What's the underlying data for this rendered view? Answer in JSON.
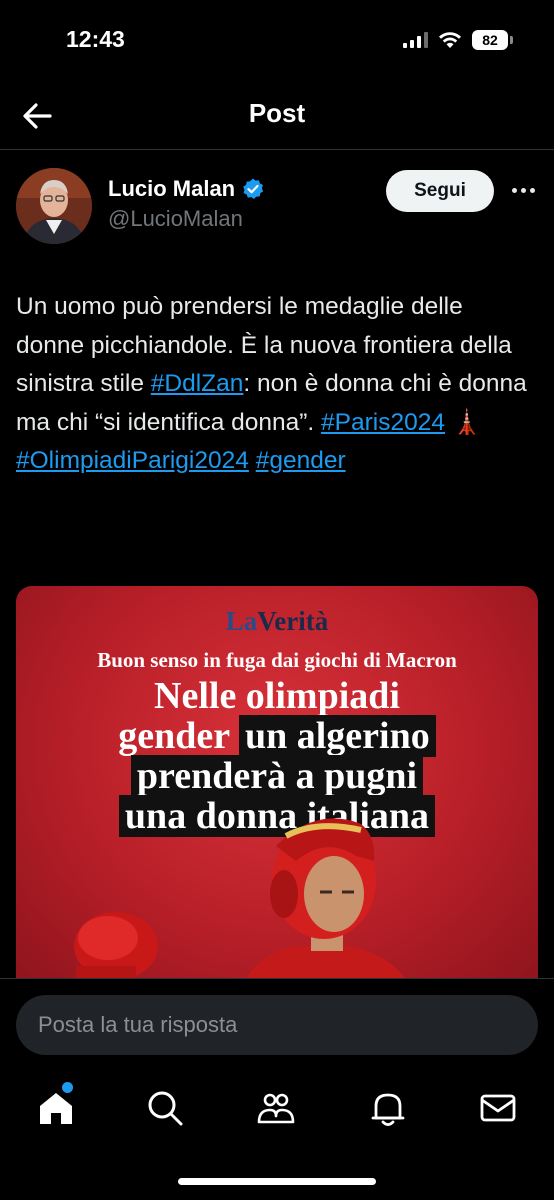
{
  "status_bar": {
    "time": "12:43",
    "battery": "82"
  },
  "header": {
    "title": "Post"
  },
  "author": {
    "name": "Lucio Malan",
    "handle": "@LucioMalan",
    "follow_label": "Segui"
  },
  "tweet": {
    "seg1": "Un uomo può prendersi le medaglie delle donne picchiandole. È la nuova frontiera della sinistra stile ",
    "tag1": "#DdlZan",
    "seg2": ": non è donna chi è donna ma chi “si identifica donna”. ",
    "tag2": "#Paris2024",
    "emoji": " 🗼",
    "tag3": "#OlimpiadiParigi2024",
    "tag4": "#gender"
  },
  "media": {
    "logo_la": "La",
    "logo_verita": "Verità",
    "kicker": "Buon senso in fuga dai giochi di Macron",
    "headline_line1": "Nelle olimpiadi",
    "headline_line2a": "gender",
    "headline_line2b": "un algerino",
    "headline_line3": "prenderà a pugni",
    "headline_line4": "una donna italiana"
  },
  "reply": {
    "placeholder": "Posta la tua risposta"
  },
  "colors": {
    "accent": "#1d9bf0",
    "background": "#000000",
    "muted_text": "#71767b"
  },
  "nav": {
    "icons": [
      "home-icon",
      "search-icon",
      "communities-icon",
      "notifications-icon",
      "messages-icon"
    ]
  }
}
